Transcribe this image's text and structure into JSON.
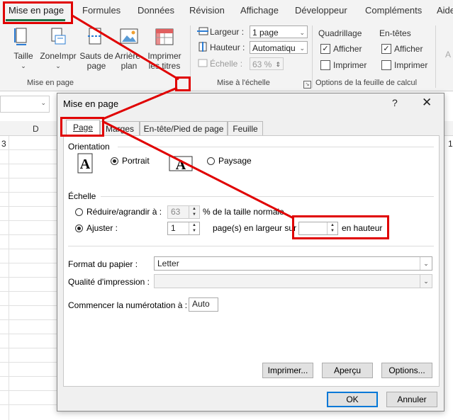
{
  "ribbon": {
    "tabs": [
      "Mise en page",
      "Formules",
      "Données",
      "Révision",
      "Affichage",
      "Développeur",
      "Compléments",
      "Aide"
    ],
    "buttons": {
      "taille": "Taille",
      "zone": "ZoneImpr",
      "sauts_line1": "Sauts de",
      "sauts_line2": "page",
      "arriere_line1": "Arrière-",
      "arriere_line2": "plan",
      "imprimer_titres_line1": "Imprimer",
      "imprimer_titres_line2": "les titres"
    },
    "group_mise_en_page": "Mise en page",
    "group_echelle": "Mise à l'échelle",
    "group_options": "Options de la feuille de calcul",
    "largeur_label": "Largeur :",
    "largeur_value": "1 page",
    "hauteur_label": "Hauteur :",
    "hauteur_value": "Automatiqu",
    "echelle_label": "Échelle :",
    "echelle_value": "63 %",
    "quadrillage": "Quadrillage",
    "entetes": "En-têtes",
    "afficher": "Afficher",
    "imprimer": "Imprimer",
    "cut_right_letter": "A"
  },
  "sheet": {
    "column_d": "D",
    "row_value_left": "3",
    "row_value_right": "1"
  },
  "dialog": {
    "title": "Mise en page",
    "help": "?",
    "close": "✕",
    "tabs": [
      "Page",
      "Marges",
      "En-tête/Pied de page",
      "Feuille"
    ],
    "orientation_label": "Orientation",
    "portrait": "Portrait",
    "paysage": "Paysage",
    "echelle_label": "Échelle",
    "reduire_label": "Réduire/agrandir à :",
    "reduire_value": "63",
    "reduire_suffix": "% de la taille normale",
    "ajuster_label": "Ajuster :",
    "ajuster_value": "1",
    "largeur_suffix": "page(s) en largeur sur",
    "hauteur_value": "",
    "hauteur_suffix": "en hauteur",
    "format_label": "Format du papier :",
    "format_value": "Letter",
    "qualite_label": "Qualité d'impression :",
    "qualite_value": "",
    "numerotation_label": "Commencer la numérotation à :",
    "numerotation_value": "Auto",
    "btn_imprimer": "Imprimer...",
    "btn_apercu": "Aperçu",
    "btn_options": "Options...",
    "btn_ok": "OK",
    "btn_annuler": "Annuler"
  },
  "colors": {
    "annotation": "#e00000",
    "accent": "#1e7145",
    "primary_border": "#0078d7"
  }
}
